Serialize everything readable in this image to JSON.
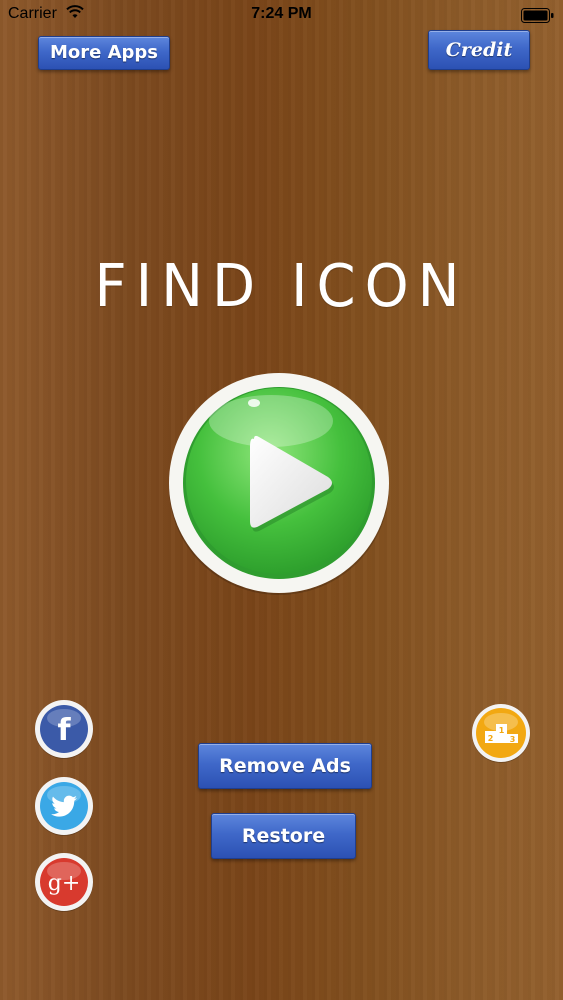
{
  "status_bar": {
    "carrier": "Carrier",
    "time": "7:24 PM"
  },
  "header": {
    "more_apps_label": "More Apps",
    "credit_label": "Credit"
  },
  "title": "FIND ICON",
  "actions": {
    "remove_ads_label": "Remove Ads",
    "restore_label": "Restore"
  },
  "social": {
    "facebook_glyph": "f",
    "google_glyph": "g+"
  },
  "icons": {
    "play": "play-icon",
    "facebook": "facebook-icon",
    "twitter": "twitter-icon",
    "google": "google-plus-icon",
    "leaderboard": "podium-icon"
  },
  "colors": {
    "button_blue": "#3f68c9",
    "play_green": "#3cbf3a",
    "background_brown": "#7c4a20",
    "leaderboard_gold": "#f2a812",
    "google_red": "#d83a2e",
    "twitter_blue": "#3aa8e6",
    "facebook_blue": "#3b5aa8"
  }
}
